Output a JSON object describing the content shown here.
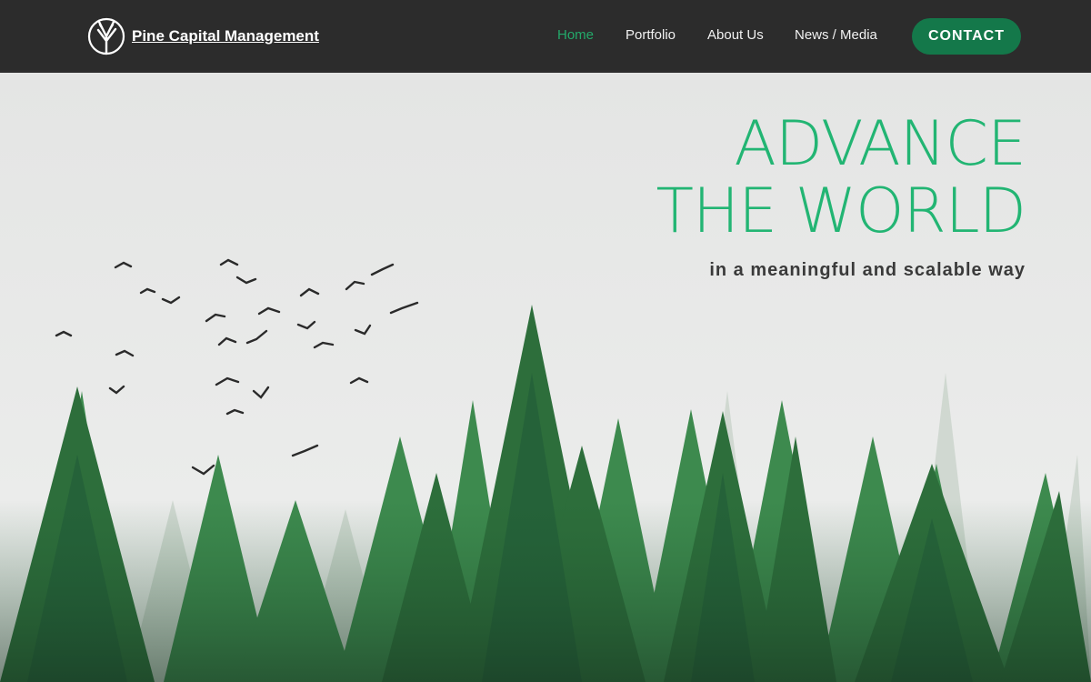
{
  "header": {
    "brand_name": "Pine Capital Management",
    "logo_icon": "pine-branch-logo-icon",
    "nav": [
      {
        "label": "Home",
        "active": true
      },
      {
        "label": "Portfolio",
        "active": false
      },
      {
        "label": "About Us",
        "active": false
      },
      {
        "label": "News / Media",
        "active": false
      }
    ],
    "contact_label": "CONTACT"
  },
  "hero": {
    "headline_line1": "ADVANCE",
    "headline_line2": "THE WORLD",
    "tagline": "in a meaningful and scalable way",
    "background_image": "forest-with-birds-image"
  },
  "colors": {
    "header_bg": "#2c2c2c",
    "accent_green": "#22b573",
    "button_green": "#14784a",
    "sky": "#e6e7e6",
    "tagline": "#3a3a3a"
  }
}
